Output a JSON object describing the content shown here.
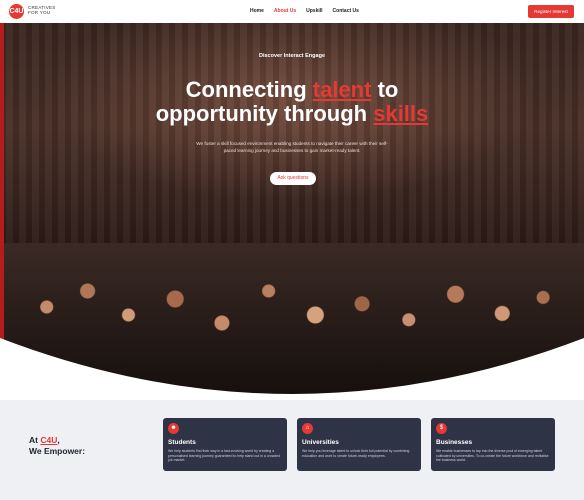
{
  "nav": {
    "logo_badge": "C4U",
    "logo_line1": "CREATIVES",
    "logo_line2": "FOR YOU",
    "items": [
      {
        "label": "Home",
        "active": false
      },
      {
        "label": "About Us",
        "active": true
      },
      {
        "label": "Upskill",
        "active": false
      },
      {
        "label": "Contact Us",
        "active": false
      }
    ],
    "register_label": "Register Interest"
  },
  "hero": {
    "tagline": "Discover Interact Engage",
    "headline_part1": "Connecting ",
    "headline_talent": "talent",
    "headline_part2": " to",
    "headline_part3": "opportunity through ",
    "headline_skills": "skills",
    "subtext": "We foster a skill focused environment enabling students to navigate their career with their self-paced learning journey and businesses to gain market-ready talent.",
    "cta_label": "Ask questions"
  },
  "empower": {
    "title_prefix": "At ",
    "title_brand": "C4U",
    "title_suffix": ",",
    "title_line2": "We Empower:",
    "cards": [
      {
        "icon": "student-icon",
        "title": "Students",
        "description": "We help students find their way in a fast-evolving world by creating a personalised learning journey guaranteed to help stand out in a crowded job market."
      },
      {
        "icon": "university-icon",
        "title": "Universities",
        "description": "We help you leverage talent to unlock their full potential by combining education and work to create future-ready employees."
      },
      {
        "icon": "business-icon",
        "title": "Businesses",
        "description": "We enable businesses to tap into the diverse pool of emerging talent cultivated by universities. To co-create the future workforce and revitalise the business world."
      }
    ]
  },
  "colors": {
    "accent": "#e53935",
    "card_bg": "#2f3346",
    "section_bg": "#eef0f4"
  }
}
